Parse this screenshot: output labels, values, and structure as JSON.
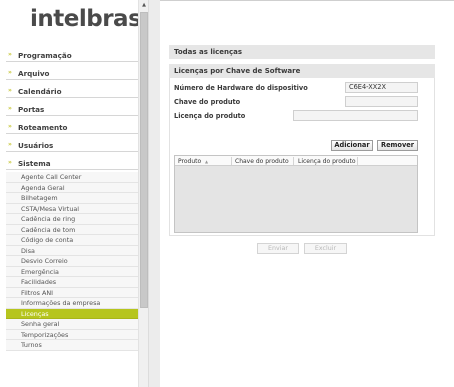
{
  "logo": {
    "text": "intelbras"
  },
  "menu": {
    "headers": [
      "Programação",
      "Arquivo",
      "Calendário",
      "Portas",
      "Roteamento",
      "Usuários",
      "Sistema"
    ],
    "sistema_items": [
      "Agente Call Center",
      "Agenda Geral",
      "Bilhetagem",
      "CSTA/Mesa Virtual",
      "Cadência de ring",
      "Cadência de tom",
      "Código de conta",
      "Disa",
      "Desvio Correio",
      "Emergência",
      "Facilidades",
      "Filtros ANI",
      "Informações da empresa",
      "Licenças",
      "Senha geral",
      "Temporizações",
      "Turnos"
    ],
    "active_item": "Licenças"
  },
  "content": {
    "section_all": "Todas as licenças",
    "section_sw": "Licenças por Chave de Software",
    "hw_label": "Número de Hardware do dispositivo",
    "hw_value": "C6E4-XX2X",
    "key_label": "Chave do produto",
    "key_value": "",
    "lic_label": "Licença do produto",
    "lic_value": "",
    "add_button": "Adicionar",
    "remove_button": "Remover",
    "table_headers": [
      "Produto",
      "Chave do produto",
      "Licença do produto"
    ],
    "sort_indicator": "▲",
    "send_button": "Enviar",
    "delete_button": "Excluir"
  },
  "colors": {
    "active": "#b6c51e",
    "arrow": "#c7c73a"
  }
}
